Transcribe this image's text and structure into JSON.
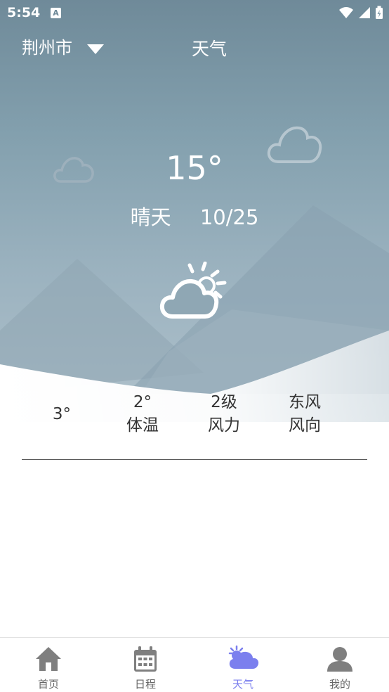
{
  "status_bar": {
    "time": "5:54",
    "notification_icon": "A"
  },
  "header": {
    "city": "荆州市",
    "title": "天气"
  },
  "weather": {
    "temperature": "15°",
    "condition": "晴天",
    "date": "10/25"
  },
  "details": [
    {
      "value": "3°",
      "label": ""
    },
    {
      "value": "2°",
      "label": "体温"
    },
    {
      "value": "2级",
      "label": "风力"
    },
    {
      "value": "东风",
      "label": "风向"
    }
  ],
  "bottom_nav": {
    "items": [
      {
        "label": "首页",
        "icon": "home-icon"
      },
      {
        "label": "日程",
        "icon": "calendar-icon"
      },
      {
        "label": "天气",
        "icon": "weather-icon",
        "active": true
      },
      {
        "label": "我的",
        "icon": "user-icon"
      }
    ]
  },
  "colors": {
    "accent": "#7b7fee",
    "hero_top": "#6f8a99",
    "hero_bottom": "#b3c4ce"
  }
}
